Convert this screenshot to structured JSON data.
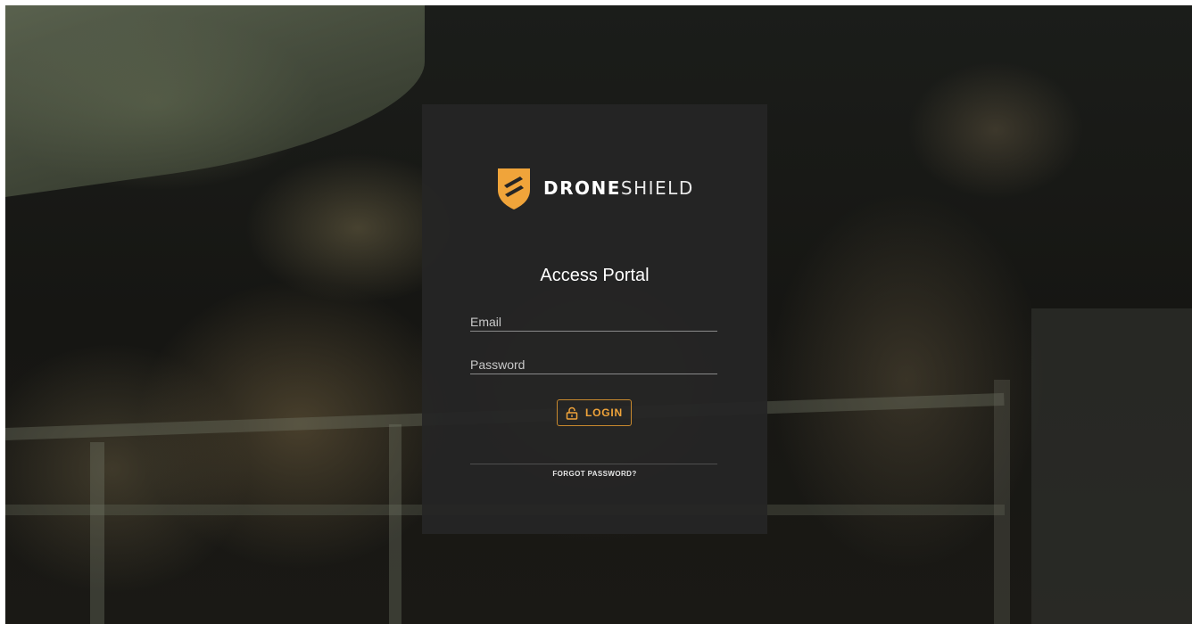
{
  "brand": {
    "name_bold": "DRONE",
    "name_light": "SHIELD",
    "accent_color": "#f0a43a",
    "logo_icon": "droneshield-shield-logo"
  },
  "login_card": {
    "title": "Access Portal",
    "email": {
      "placeholder": "Email",
      "value": ""
    },
    "password": {
      "placeholder": "Password",
      "value": ""
    },
    "login_button": {
      "label": "LOGIN",
      "icon": "lock-icon"
    },
    "forgot_password_link": "FORGOT PASSWORD?"
  },
  "background": {
    "description_icon": "soldiers-background-photo"
  }
}
